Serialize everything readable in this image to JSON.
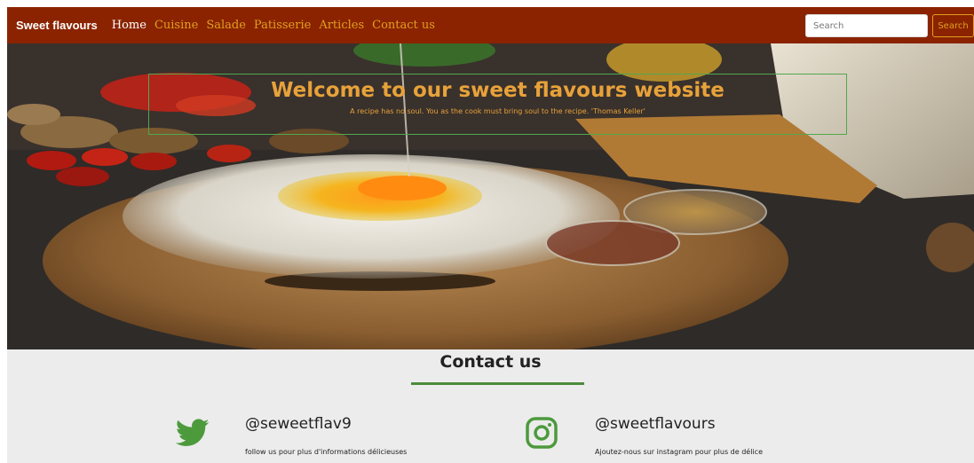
{
  "navbar": {
    "brand": "Sweet flavours",
    "links": [
      "Home",
      "Cuisine",
      "Salade",
      "Patisserie",
      "Articles",
      "Contact us"
    ],
    "search_placeholder": "Search",
    "search_button": "Search",
    "colors": {
      "background": "#8b2300",
      "link": "#e0a020",
      "active": "#ffffff"
    }
  },
  "hero": {
    "title": "Welcome to our sweet flavours website",
    "quote": "A recipe has no soul. You as the cook must bring soul to the recipe. 'Thomas Keller'",
    "colors": {
      "text": "#e8a23a",
      "frame": "#4fa84f"
    }
  },
  "contact": {
    "title": "Contact us",
    "accent": "#4c8c3c",
    "socials": [
      {
        "icon": "twitter-icon",
        "handle": "@seweetflav9",
        "text": "follow us pour plus d'informations délicieuses"
      },
      {
        "icon": "instagram-icon",
        "handle": "@sweetflavours",
        "text": "Ajoutez-nous sur instagram pour plus de délice"
      }
    ]
  }
}
